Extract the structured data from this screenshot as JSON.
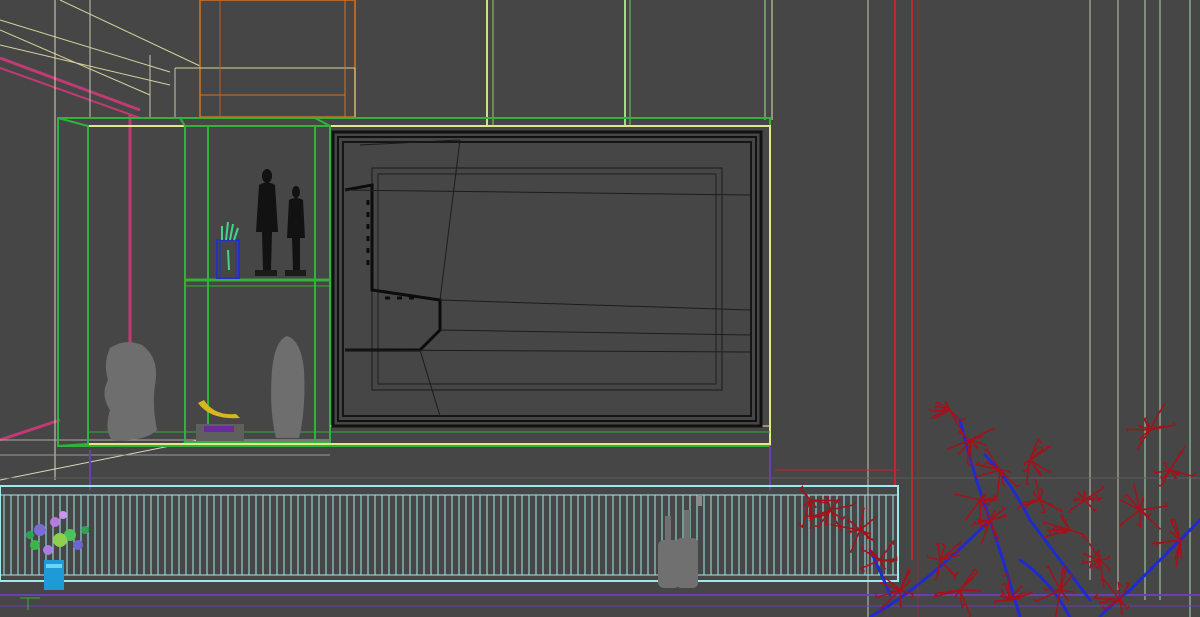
{
  "viewport": {
    "view_type": "3D wireframe perspective viewport",
    "text_labels": []
  },
  "colors": {
    "background": "#464646",
    "cabinet_green": "#2fb33a",
    "cabinet_yellow": "#e6e68a",
    "tv_black": "#111111",
    "sofa_cyan": "#9ee9ee",
    "plant_red": "#a3121a",
    "plant_blue": "#1f2bd0",
    "wall_red": "#c1272d",
    "ceiling_orange": "#d27424",
    "decor_gray": "#6e6e6e",
    "statue_black": "#121212",
    "purple_line": "#6a3fb0",
    "pink_line": "#c03a73"
  },
  "objects": [
    {
      "name": "tv-panel",
      "icon": "tv-icon"
    },
    {
      "name": "display-cabinet",
      "icon": "cabinet-icon"
    },
    {
      "name": "ceiling-box",
      "icon": "box-icon"
    },
    {
      "name": "sofa",
      "icon": "sofa-icon"
    },
    {
      "name": "decor-plant",
      "icon": "plant-icon"
    },
    {
      "name": "figurines",
      "icon": "statue-icon"
    },
    {
      "name": "vase",
      "icon": "vase-icon"
    }
  ]
}
